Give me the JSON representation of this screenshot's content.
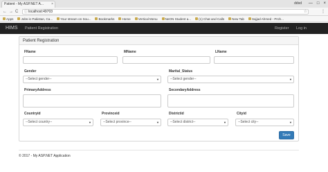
{
  "browser": {
    "tab_title": "Patient - My ASP.NET A...",
    "tab_close": "×",
    "user": "ddxd",
    "window_buttons": [
      "—",
      "□",
      "×"
    ],
    "nav_back": "←",
    "nav_forward": "→",
    "nav_reload": "C",
    "url": "localhost:49703",
    "star": "☆",
    "menu": "⋮",
    "bookmarks": [
      {
        "label": "Apps"
      },
      {
        "label": "Jobs in Pakistan, Ca..."
      },
      {
        "label": "Your stream on Sou..."
      },
      {
        "label": "Bookmarks"
      },
      {
        "label": "Home"
      },
      {
        "label": "Vertical Menu"
      },
      {
        "label": "NeON Student a..."
      },
      {
        "label": "(1) Chat and Calls"
      },
      {
        "label": "New Tab"
      },
      {
        "label": "Sajjad Ahmed - Proh..."
      }
    ]
  },
  "app": {
    "brand": "HIMS",
    "nav": {
      "registration": "Patient Registration",
      "register": "Register",
      "login": "Log in"
    }
  },
  "panel": {
    "heading": "Patient Registration"
  },
  "form": {
    "fname_label": "FName",
    "mname_label": "MName",
    "lname_label": "LName",
    "gender_label": "Gender",
    "gender_value": "--Select gender--",
    "marital_label": "Marital_Status",
    "marital_value": "--Select gender--",
    "primary_label": "PrimaryAddress",
    "secondary_label": "SecondaryAddress",
    "country_label": "Countryid",
    "country_value": "--Select country--",
    "province_label": "Provinceid",
    "province_value": "--Select province--",
    "district_label": "Districtid",
    "district_value": "--Select district--",
    "city_label": "Cityid",
    "city_value": "--Select city--",
    "save_label": "Save"
  },
  "footer": {
    "text": "© 2017 - My ASP.NET Application"
  },
  "colors": {
    "navbar": "#222222",
    "primary": "#337ab7"
  }
}
